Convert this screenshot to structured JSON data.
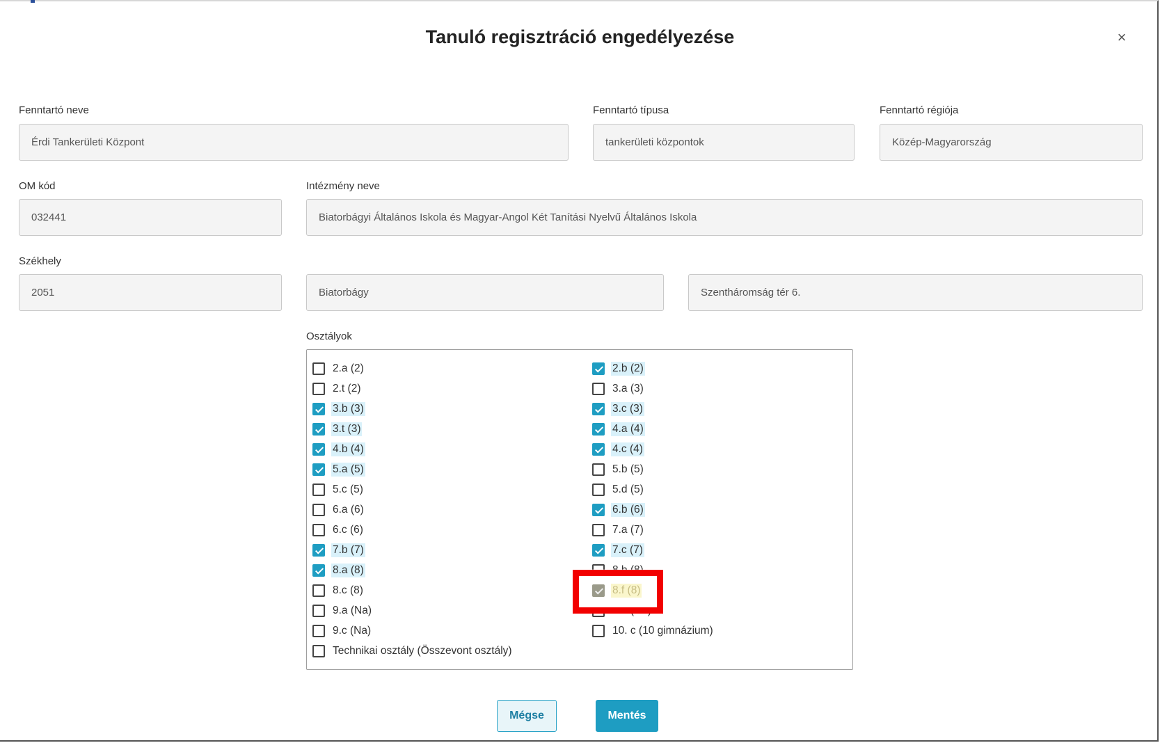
{
  "dialog": {
    "title": "Tanuló regisztráció engedélyezése",
    "close_icon": "×"
  },
  "fields": {
    "fenntarto_neve": {
      "label": "Fenntartó neve",
      "value": "Érdi Tankerületi Központ"
    },
    "fenntarto_tipusa": {
      "label": "Fenntartó típusa",
      "value": "tankerületi központok"
    },
    "fenntarto_regioja": {
      "label": "Fenntartó régiója",
      "value": "Közép-Magyarország"
    },
    "om_kod": {
      "label": "OM kód",
      "value": "032441"
    },
    "intezmeny_neve": {
      "label": "Intézmény neve",
      "value": "Biatorbágyi Általános Iskola és Magyar-Angol Két Tanítási Nyelvű Általános Iskola"
    },
    "szekhely": {
      "label": "Székhely",
      "zip": "2051",
      "city": "Biatorbágy",
      "street": "Szentháromság tér 6."
    }
  },
  "classes": {
    "label": "Osztályok",
    "left": [
      {
        "label": "2.a (2)",
        "checked": false
      },
      {
        "label": "2.t (2)",
        "checked": false
      },
      {
        "label": "3.b (3)",
        "checked": true
      },
      {
        "label": "3.t (3)",
        "checked": true
      },
      {
        "label": "4.b (4)",
        "checked": true
      },
      {
        "label": "5.a (5)",
        "checked": true
      },
      {
        "label": "5.c (5)",
        "checked": false
      },
      {
        "label": "6.a (6)",
        "checked": false
      },
      {
        "label": "6.c (6)",
        "checked": false
      },
      {
        "label": "7.b (7)",
        "checked": true
      },
      {
        "label": "8.a (8)",
        "checked": true
      },
      {
        "label": "8.c (8)",
        "checked": false
      },
      {
        "label": "9.a (Na)",
        "checked": false
      },
      {
        "label": "9.c (Na)",
        "checked": false
      },
      {
        "label": "Technikai osztály (Összevont osztály)",
        "checked": false
      }
    ],
    "right": [
      {
        "label": "2.b (2)",
        "checked": true
      },
      {
        "label": "3.a (3)",
        "checked": false
      },
      {
        "label": "3.c (3)",
        "checked": true
      },
      {
        "label": "4.a (4)",
        "checked": true
      },
      {
        "label": "4.c (4)",
        "checked": true
      },
      {
        "label": "5.b (5)",
        "checked": false
      },
      {
        "label": "5.d (5)",
        "checked": false
      },
      {
        "label": "6.b (6)",
        "checked": true
      },
      {
        "label": "7.a (7)",
        "checked": false
      },
      {
        "label": "7.c (7)",
        "checked": true
      },
      {
        "label": "8.b (8)",
        "checked": false,
        "partially_hidden": "top"
      },
      {
        "label": "8.f (8)",
        "checked": true,
        "disabled": true
      },
      {
        "label": "9.b (Na)",
        "checked": false,
        "partially_hidden": "bottom"
      },
      {
        "label": "10. c (10 gimnázium)",
        "checked": false
      }
    ]
  },
  "buttons": {
    "cancel": "Mégse",
    "save": "Mentés"
  }
}
